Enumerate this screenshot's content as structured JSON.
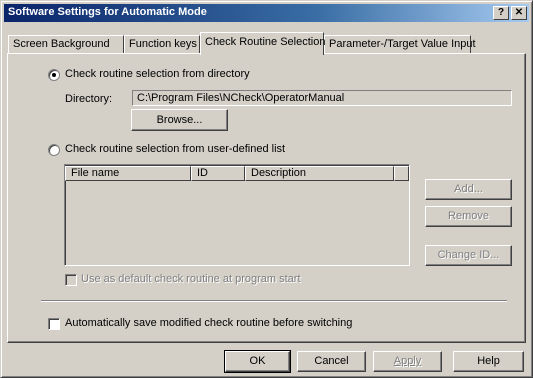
{
  "window": {
    "title": "Software Settings for Automatic Mode",
    "help_glyph": "?",
    "close_glyph": "✕"
  },
  "tabs": [
    {
      "label": "Screen Background"
    },
    {
      "label": "Function keys"
    },
    {
      "label": "Check Routine Selection",
      "active": true
    },
    {
      "label": "Parameter-/Target Value Input"
    }
  ],
  "panel": {
    "radio_directory": {
      "label": "Check routine selection from directory",
      "selected": true
    },
    "directory_label": "Directory:",
    "directory_value": "C:\\Program Files\\NCheck\\OperatorManual",
    "browse_label": "Browse...",
    "radio_userlist": {
      "label": "Check routine selection from user-defined list",
      "selected": false
    },
    "list_columns": [
      "File name",
      "ID",
      "Description"
    ],
    "list_rows": [],
    "add_label": "Add...",
    "remove_label": "Remove",
    "change_id_label": "Change ID...",
    "use_default_label": "Use as default check routine at program start",
    "use_default_checked": false,
    "autosave_label": "Automatically save modified check routine before switching",
    "autosave_checked": false
  },
  "footer": {
    "ok_label": "OK",
    "cancel_label": "Cancel",
    "apply_label": "Apply",
    "help_label": "Help"
  }
}
